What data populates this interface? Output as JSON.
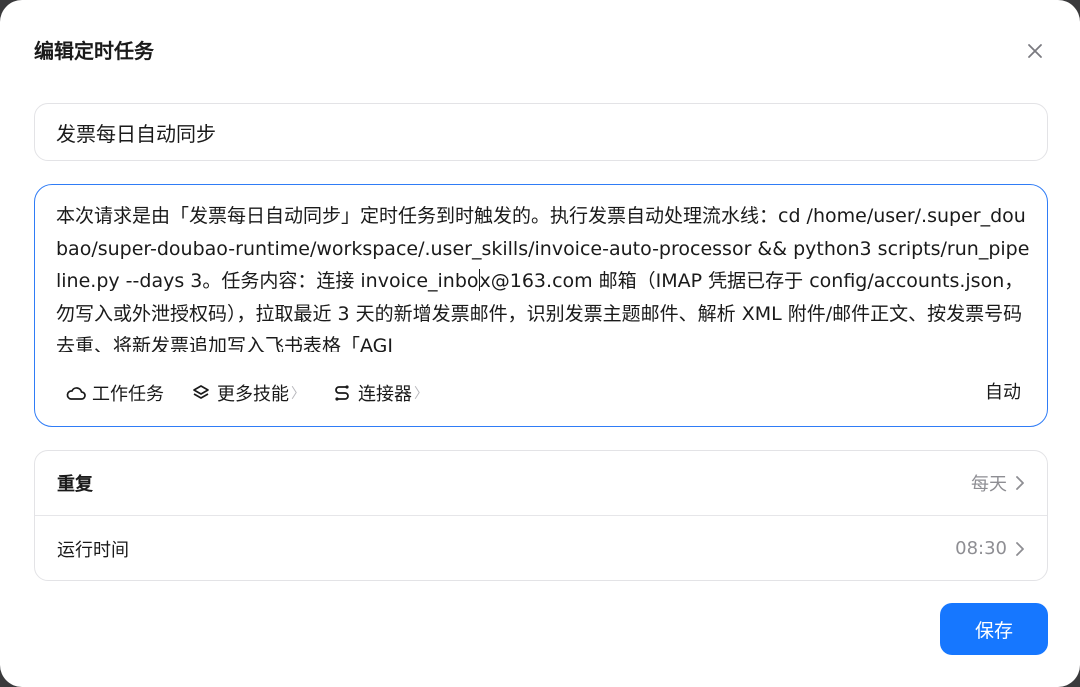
{
  "dialog": {
    "title": "编辑定时任务",
    "close_icon": "close-icon"
  },
  "task": {
    "name": "发票每日自动同步",
    "prompt_before_caret": "本次请求是由「发票每日自动同步」定时任务到时触发的。执行发票自动处理流水线：cd /home/user/.super_doubao/super-doubao-runtime/workspace/.user_skills/invoice-auto-processor && python3 scripts/run_pipeline.py --days 3。任务内容：连接 invoice_inbo",
    "prompt_after_caret": "x@163.com 邮箱（IMAP 凭据已存于 config/accounts.json，勿写入或外泄授权码），拉取最近 3 天的新增发票邮件，识别发票主题邮件、解析 XML 附件/邮件正文、按发票号码去重、将新发票追加写入飞书表格「AGI"
  },
  "toolbar": {
    "work_task_label": "工作任务",
    "more_skills_label": "更多技能",
    "connector_label": "连接器",
    "chevron": "〉",
    "mode_label": "自动"
  },
  "schedule": {
    "repeat_label": "重复",
    "repeat_value": "每天",
    "time_label": "运行时间",
    "time_value": "08:30"
  },
  "actions": {
    "save_label": "保存"
  },
  "colors": {
    "accent": "#1677ff",
    "focus_border": "#2f7cf6",
    "muted_text": "#8e8e93"
  }
}
